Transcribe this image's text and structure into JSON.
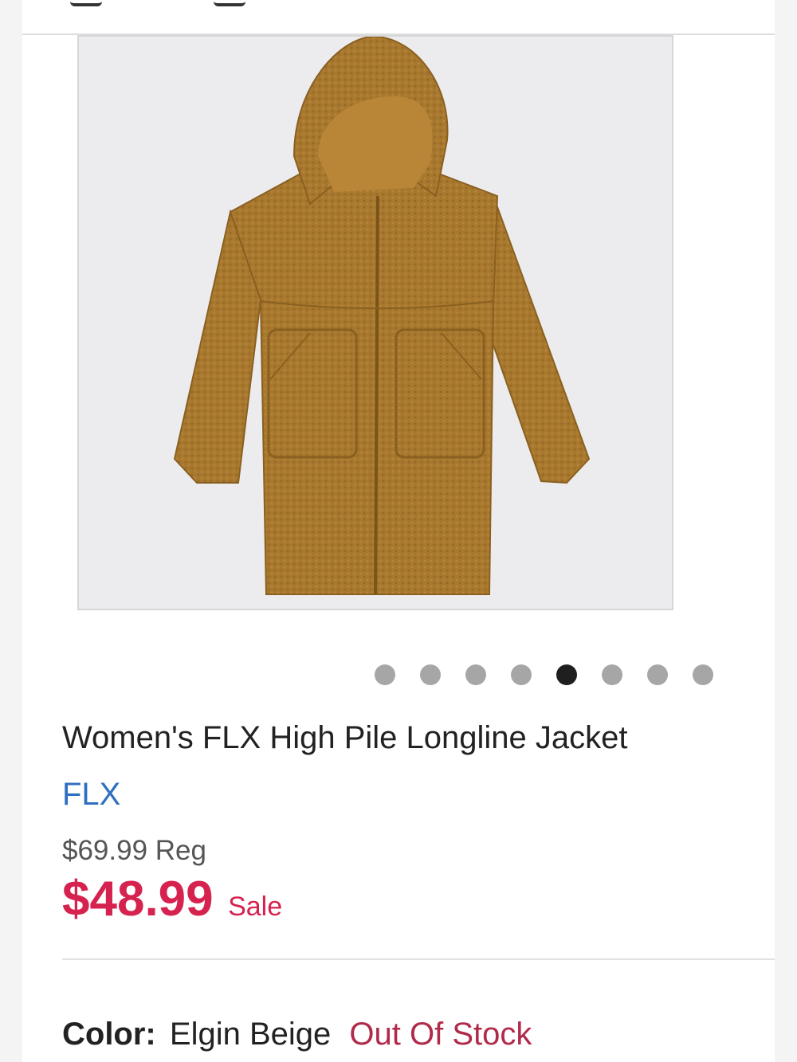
{
  "product": {
    "title": "Women's FLX High Pile Longline Jacket",
    "brand": "FLX",
    "regular_price": "$69.99 Reg",
    "sale_price": "$48.99",
    "sale_label": "Sale",
    "color_label": "Color:",
    "color_value": "Elgin Beige",
    "stock_status": "Out Of Stock",
    "image_alt": "Women's FLX High Pile Longline Jacket"
  },
  "carousel": {
    "total_images": 8,
    "active_index": 5
  },
  "colors": {
    "accent_sale": "#d6224f",
    "brand_link": "#2f6fbf",
    "out_of_stock": "#b02a4a",
    "jacket": "#a8782e"
  }
}
